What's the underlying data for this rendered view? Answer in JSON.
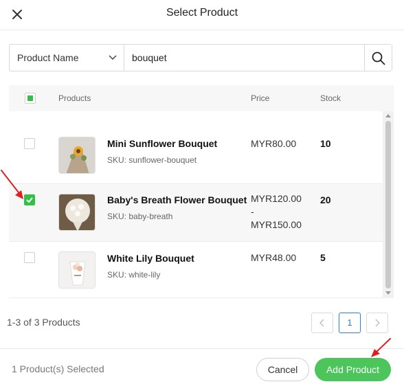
{
  "header": {
    "title": "Select Product",
    "close_icon": "close-icon"
  },
  "search": {
    "field_select": "Product Name",
    "query": "bouquet",
    "icon": "search-icon"
  },
  "table": {
    "columns": {
      "products": "Products",
      "price": "Price",
      "stock": "Stock"
    },
    "rows": [
      {
        "name": "Mini Sunflower Bouquet",
        "sku": "SKU: sunflower-bouquet",
        "price_line1": "MYR80.00",
        "price_line2": "",
        "price_line3": "",
        "stock": "10",
        "selected": false
      },
      {
        "name": "Baby's Breath Flower Bouquet",
        "sku": "SKU: baby-breath",
        "price_line1": "MYR120.00",
        "price_line2": "-",
        "price_line3": "MYR150.00",
        "stock": "20",
        "selected": true
      },
      {
        "name": "White Lily Bouquet",
        "sku": "SKU: white-lily",
        "price_line1": "MYR48.00",
        "price_line2": "",
        "price_line3": "",
        "stock": "5",
        "selected": false
      }
    ]
  },
  "pagination": {
    "info": "1-3 of 3 Products",
    "current_page": "1"
  },
  "footer": {
    "selected_count": "1 Product(s) Selected",
    "cancel_label": "Cancel",
    "add_label": "Add Product"
  },
  "colors": {
    "accent_green": "#4cc65a",
    "checkbox_green": "#33c046",
    "page_active": "#2d7be5",
    "annotation_red": "#e02020"
  }
}
